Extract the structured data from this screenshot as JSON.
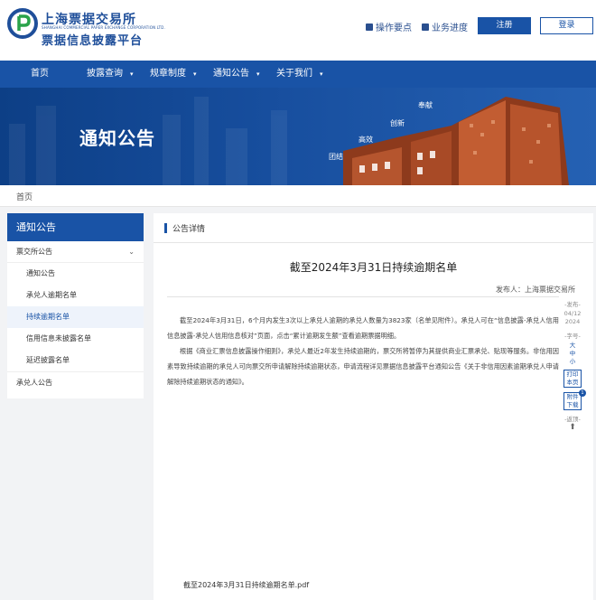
{
  "header": {
    "logo_line1": "上海票据交易所",
    "logo_en": "SHANGHAI COMMERCIAL PAPER EXCHANGE CORPORATION LTD.",
    "logo_line2": "票据信息披露平台",
    "link_ops": "操作要点",
    "link_progress": "业务进度",
    "register": "注册",
    "login": "登录"
  },
  "nav": {
    "items": [
      {
        "label": "首页",
        "dropdown": false
      },
      {
        "label": "披露查询",
        "dropdown": true
      },
      {
        "label": "规章制度",
        "dropdown": true
      },
      {
        "label": "通知公告",
        "dropdown": true
      },
      {
        "label": "关于我们",
        "dropdown": true
      }
    ]
  },
  "banner": {
    "title": "通知公告",
    "tags": [
      "团结",
      "高效",
      "创新",
      "奉献"
    ]
  },
  "breadcrumb": {
    "home": "首页"
  },
  "sidebar": {
    "title": "通知公告",
    "items": [
      {
        "label": "票交所公告",
        "level": 1,
        "expanded": true
      },
      {
        "label": "通知公告",
        "level": 2
      },
      {
        "label": "承兑人逾期名单",
        "level": 2
      },
      {
        "label": "持续逾期名单",
        "level": 2,
        "active": true
      },
      {
        "label": "信用信息未披露名单",
        "level": 2
      },
      {
        "label": "延迟披露名单",
        "level": 2
      },
      {
        "label": "承兑人公告",
        "level": 1
      }
    ]
  },
  "main": {
    "section_title": "公告详情",
    "title": "截至2024年3月31日持续逾期名单",
    "publisher": "发布人：上海票据交易所",
    "paragraph1": "截至2024年3月31日，6个月内发生3次以上承兑人逾期的承兑人数量为3823家（名单见附件）。承兑人可在“信息披露-承兑人信用信息披露-承兑人信用信息核对”页面，点击“累计逾期发生额”查看逾期票据明细。",
    "paragraph2": "根据《商业汇票信息披露操作细则》，承兑人最近2年发生持续逾期的，票交所将暂停为其提供商业汇票承兑、贴现等服务。非信用因素导致持续逾期的承兑人可向票交所申请解除持续逾期状态，申请流程详见票据信息披露平台通知公告《关于非信用因素逾期承兑人申请解除持续逾期状态的通知》。",
    "attachment": "截至2024年3月31日持续逾期名单.pdf"
  },
  "tools": {
    "publish_label": "-发布-",
    "publish_date_1": "04/12",
    "publish_date_2": "2024",
    "font_label": "-字号-",
    "font_large": "大",
    "font_medium": "中",
    "font_small": "小",
    "print_1": "打印",
    "print_2": "本页",
    "attach_1": "附件",
    "attach_2": "下载",
    "attach_count": "1",
    "back_top": "-返顶-"
  },
  "colors": {
    "brand_blue": "#1953a6",
    "banner_building": "#b5552e"
  }
}
